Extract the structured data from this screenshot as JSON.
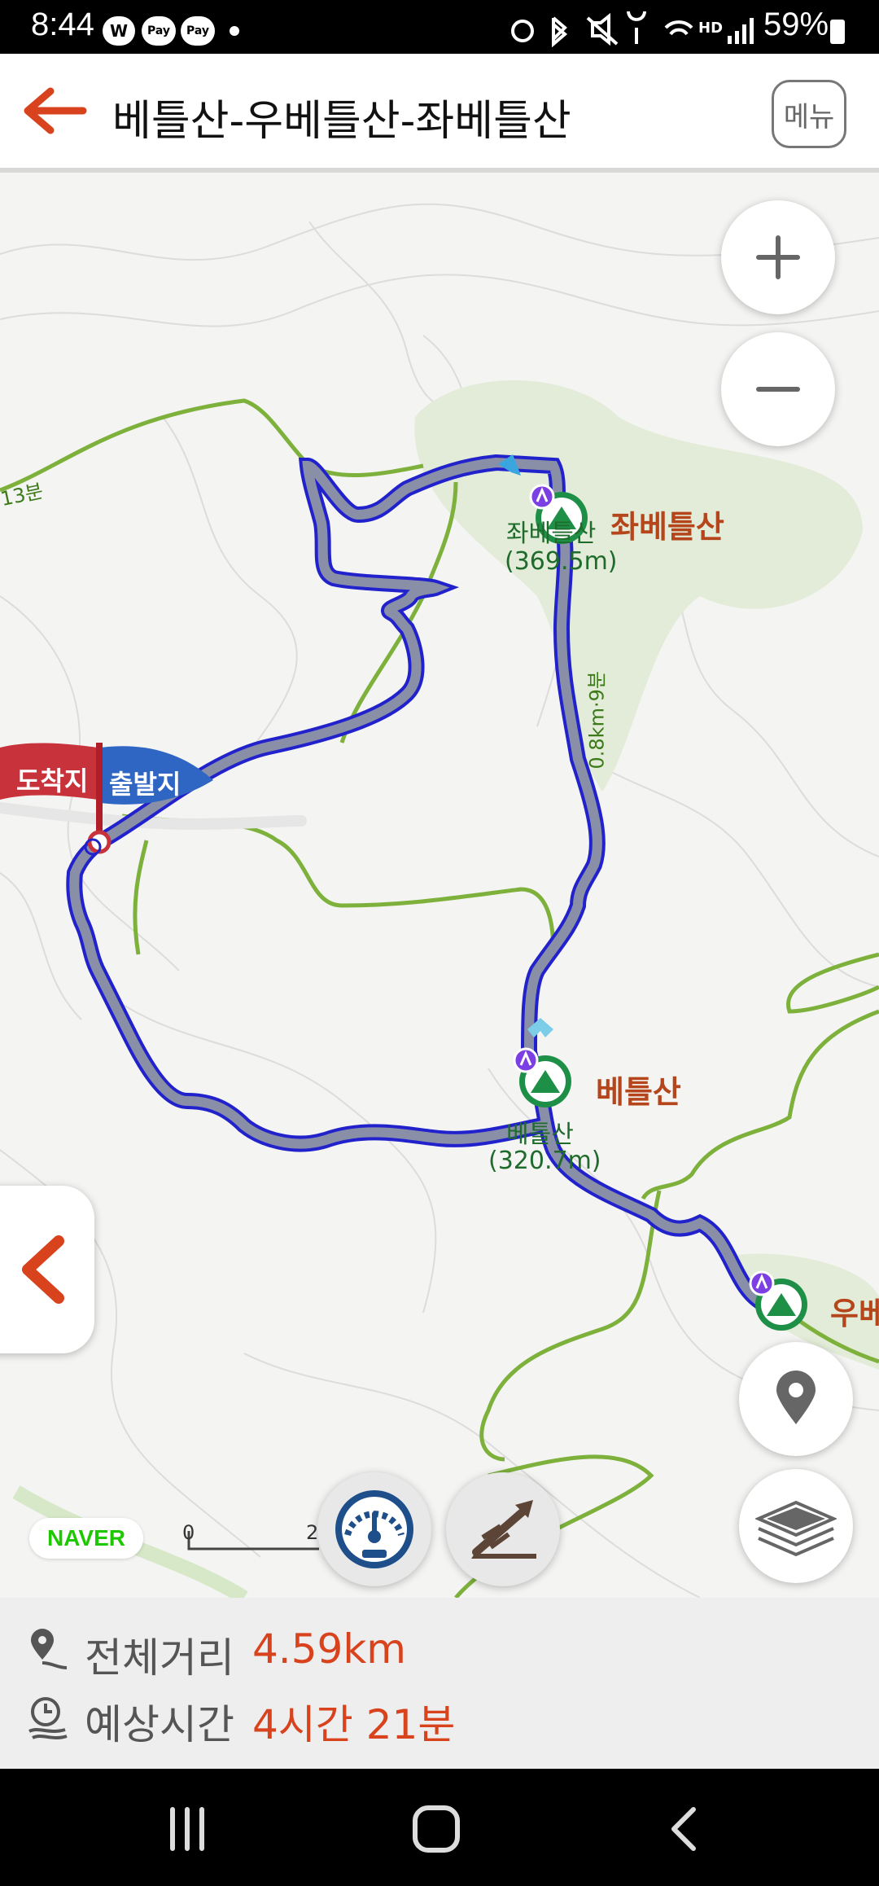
{
  "status_bar": {
    "time": "8:44",
    "app_icons": [
      "W",
      "Pay",
      "Pay"
    ],
    "battery": "59%"
  },
  "header": {
    "title": "베틀산-우베틀산-좌베틀산",
    "menu_label": "메뉴"
  },
  "map": {
    "start_label": "출발지",
    "end_label": "도착지",
    "peaks": [
      {
        "name": "좌베틀산",
        "map_label": "좌베틀산",
        "elevation": "(369.5m)"
      },
      {
        "name": "베틀산",
        "map_label": "베틀산",
        "elevation": "(320.7m)"
      },
      {
        "name": "우베틀산"
      }
    ],
    "trail_label_left": "13분",
    "trail_label_segment": "0.8km·9분",
    "provider": "NAVER",
    "scale": {
      "start": "0",
      "end": "2"
    }
  },
  "info": {
    "distance_label": "전체거리",
    "distance_value": "4.59km",
    "time_label": "예상시간",
    "time_value": "4시간 21분"
  },
  "colors": {
    "accent": "#d8431e",
    "route_fill": "#8a8fa8",
    "route_border": "#2222cc",
    "trail": "#7db13c",
    "peak_green": "#1e8f47"
  }
}
